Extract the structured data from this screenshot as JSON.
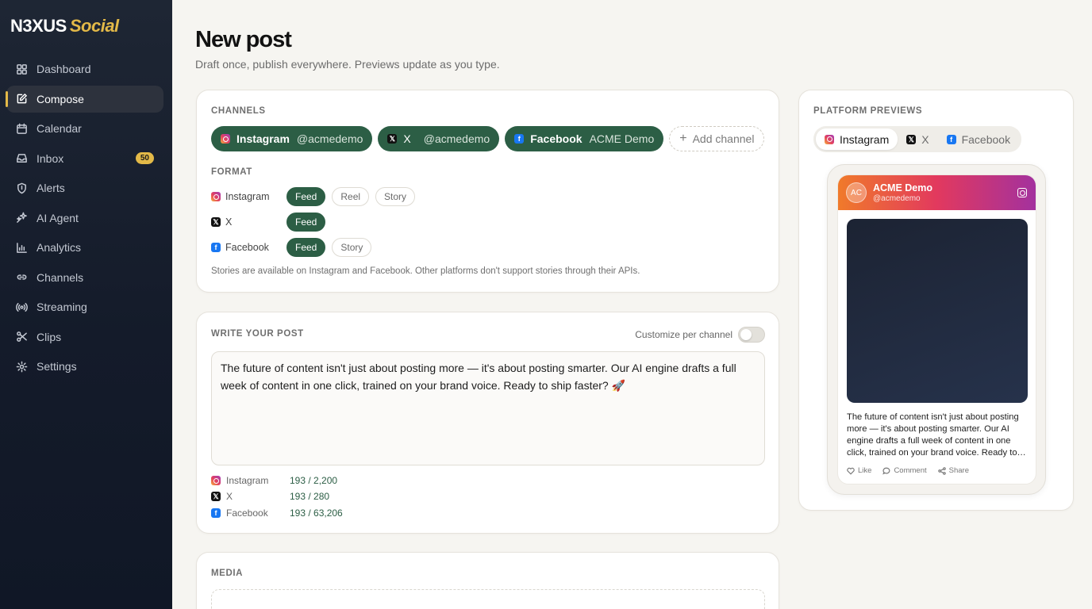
{
  "brand": {
    "name": "N3XUS",
    "accent": "Social"
  },
  "nav": [
    {
      "label": "Dashboard",
      "icon": "grid-icon"
    },
    {
      "label": "Compose",
      "icon": "edit-icon",
      "active": true
    },
    {
      "label": "Calendar",
      "icon": "calendar-icon"
    },
    {
      "label": "Inbox",
      "icon": "inbox-icon",
      "badge": "50"
    },
    {
      "label": "Alerts",
      "icon": "shield-icon"
    },
    {
      "label": "AI Agent",
      "icon": "sparkle-icon"
    },
    {
      "label": "Analytics",
      "icon": "bar-chart-icon"
    },
    {
      "label": "Channels",
      "icon": "link-icon"
    },
    {
      "label": "Streaming",
      "icon": "broadcast-icon"
    },
    {
      "label": "Clips",
      "icon": "scissors-icon"
    },
    {
      "label": "Settings",
      "icon": "gear-icon"
    }
  ],
  "header": {
    "title": "New post",
    "subtitle": "Draft once, publish everywhere. Previews update as you type."
  },
  "channels": {
    "label": "CHANNELS",
    "chips": [
      {
        "platform": "Instagram",
        "handle": "@acmedemo"
      },
      {
        "platform": "X",
        "handle": "@acmedemo"
      },
      {
        "platform": "Facebook",
        "handle": "ACME Demo"
      }
    ],
    "add_label": "Add channel"
  },
  "format": {
    "label": "FORMAT",
    "rows": [
      {
        "platform": "Instagram",
        "options": [
          "Feed",
          "Reel",
          "Story"
        ],
        "selected": "Feed"
      },
      {
        "platform": "X",
        "options": [
          "Feed"
        ],
        "selected": "Feed"
      },
      {
        "platform": "Facebook",
        "options": [
          "Feed",
          "Story"
        ],
        "selected": "Feed"
      }
    ],
    "note": "Stories are available on Instagram and Facebook. Other platforms don't support stories through their APIs."
  },
  "write": {
    "label": "WRITE YOUR POST",
    "customize_label": "Customize per channel",
    "customize_on": false,
    "text": "The future of content isn't just about posting more — it's about posting smarter. Our AI engine drafts a full week of content in one click, trained on your brand voice. Ready to ship faster? 🚀",
    "counts": [
      {
        "platform": "Instagram",
        "count": "193 / 2,200"
      },
      {
        "platform": "X",
        "count": "193 / 280"
      },
      {
        "platform": "Facebook",
        "count": "193 / 63,206"
      }
    ]
  },
  "media": {
    "label": "MEDIA"
  },
  "previews": {
    "label": "PLATFORM PREVIEWS",
    "tabs": [
      "Instagram",
      "X",
      "Facebook"
    ],
    "active_tab": "Instagram",
    "card": {
      "avatar": "AC",
      "name": "ACME Demo",
      "handle": "@acmedemo",
      "caption": "The future of content isn't just about posting more — it's about posting smarter. Our AI engine drafts a full week of content in one click, trained on your brand voice. Ready to ship faster? 🚀",
      "actions": [
        "Like",
        "Comment",
        "Share"
      ]
    }
  },
  "colors": {
    "accent": "#e3b948",
    "primary": "#2c5e45",
    "sidebar": "#1a2130"
  }
}
